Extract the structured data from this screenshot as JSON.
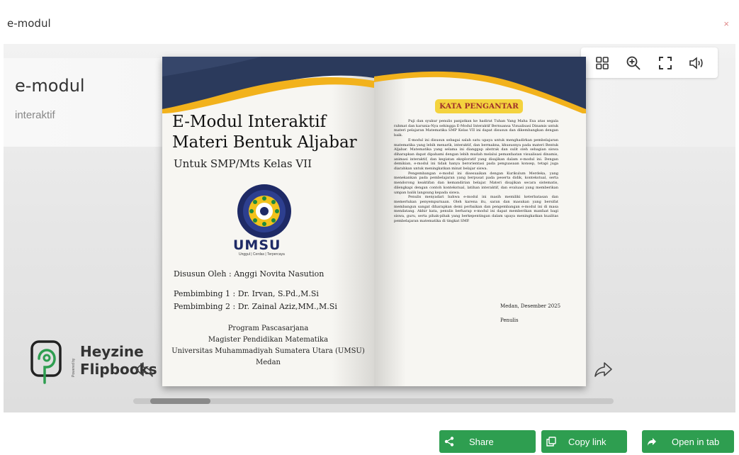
{
  "window": {
    "title": "e-modul",
    "close_glyph": "×"
  },
  "side": {
    "title": "e-modul",
    "subtitle": "interaktif"
  },
  "toolbar": {
    "icons": [
      "grid-icon",
      "zoom-in-icon",
      "fullscreen-icon",
      "sound-icon"
    ]
  },
  "left_page": {
    "title_line1": "E-Modul Interaktif",
    "title_line2": "Materi Bentuk Aljabar",
    "subtitle": "Untuk SMP/Mts Kelas VII",
    "logo_text": "UMSU",
    "logo_tagline": "Unggul | Cerdas | Terpercaya",
    "author": "Disusun Oleh : Anggi Novita Nasution",
    "supervisor1": "Pembimbing 1 : Dr. Irvan, S.Pd.,M.Si",
    "supervisor2": "Pembimbing 2 : Dr. Zainal Aziz,MM.,M.Si",
    "program": "Program Pascasarjana",
    "degree": "Magister Pendidikan Matematika",
    "university": "Universitas Muhammadiyah Sumatera Utara (UMSU)",
    "city": "Medan"
  },
  "right_page": {
    "heading": "KATA PENGANTAR",
    "p1": "Puji dan syukur penulis panjatkan ke hadirat Tuhan Yang Maha Esa atas segala rahmat dan karunia-Nya sehingga E-Modul Interaktif Bernuansa Visualisasi Dinamis untuk materi pelajaran Matematika SMP Kelas VII ini dapat disusun dan dikembangkan dengan baik.",
    "p2": "E-modul ini disusun sebagai salah satu upaya untuk menghadirkan pembelajaran matematika yang lebih menarik, interaktif, dan bermakna, khususnya pada materi Bentuk Aljabar. Matematika yang selama ini dianggap abstrak dan sulit oleh sebagian siswa diharapkan dapat dipahami dengan lebih mudah melalui pemanfaatan visualisasi dinamis, animasi interaktif, dan kegiatan eksploratif yang disajikan dalam e-modul ini. Dengan demikian, e-modul ini tidak hanya berorientasi pada penguasaan konsep, tetapi juga diarahkan untuk meningkatkan minat belajar siswa.",
    "p3": "Pengembangan e-modul ini disesuaikan dengan Kurikulum Merdeka, yang menekankan pada pembelajaran yang berpusat pada peserta didik, kontekstual, serta mendorong keaktifan dan kemandirian belajar. Materi disajikan secara sistematis, dilengkapi dengan contoh kontekstual, latihan interaktif, dan evaluasi yang memberikan umpan balik langsung kepada siswa.",
    "p4": "Penulis menyadari bahwa e-modul ini masih memiliki keterbatasan dan memerlukan penyempurnaan. Oleh karena itu, saran dan masukan yang bersifat membangun sangat diharapkan demi perbaikan dan pengembangan e-modul ini di masa mendatang. Akhir kata, penulis berharap e-modul ini dapat memberikan manfaat bagi siswa, guru, serta pihak-pihak yang berkepentingan dalam upaya meningkatkan kualitas pembelajaran matematika di tingkat SMP.",
    "sign_place": "Medan,  Desember 2025",
    "sign_name": "Penulis"
  },
  "brand": {
    "line1": "Heyzine",
    "line2": "Flipbooks",
    "powered": "Powered by"
  },
  "scroll": {
    "position": 0.04
  },
  "buttons": {
    "share": "Share",
    "copy": "Copy link",
    "open": "Open in tab"
  },
  "colors": {
    "accent_green": "#2e9e50",
    "banner_navy": "#2b3a5c",
    "banner_yellow": "#f2b21c",
    "close_red": "#e08a8a"
  }
}
